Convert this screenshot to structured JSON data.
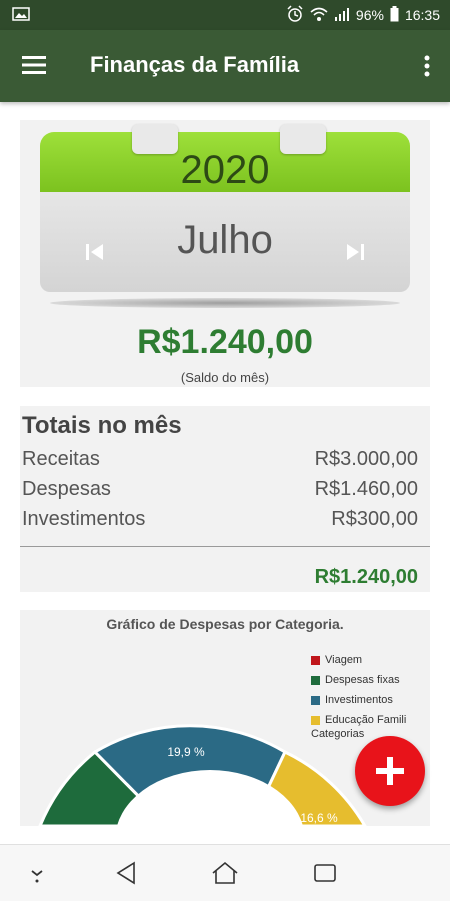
{
  "status_bar": {
    "battery": "96%",
    "time": "16:35",
    "icons": [
      "image-icon",
      "alarm-icon",
      "wifi-icon",
      "signal-icon",
      "battery-icon"
    ]
  },
  "app_bar": {
    "title": "Finanças da Família",
    "menu_icon": "hamburger-menu-icon",
    "more_icon": "more-vert-icon"
  },
  "calendar": {
    "year": "2020",
    "month": "Julho",
    "prev_icon": "skip-previous-icon",
    "next_icon": "skip-next-icon"
  },
  "balance": {
    "value": "R$1.240,00",
    "label": "(Saldo do mês)"
  },
  "totals": {
    "title": "Totais no mês",
    "rows": [
      {
        "label": "Receitas",
        "value": "R$3.000,00"
      },
      {
        "label": "Despesas",
        "value": "R$1.460,00"
      },
      {
        "label": "Investimentos",
        "value": "R$300,00"
      }
    ],
    "sum": "R$1.240,00"
  },
  "chart": {
    "title": "Gráfico de Despesas por Categoria.",
    "legend": [
      {
        "label": "Viagem",
        "color": "#c0161b"
      },
      {
        "label": "Despesas fixas",
        "color": "#1e6b3c"
      },
      {
        "label": "Investimentos",
        "color": "#2b6a85"
      },
      {
        "label": "Educação Famili",
        "color": "#e6bd2e"
      }
    ],
    "legend_caption": "Categorias",
    "visible_labels": [
      "19,9 %",
      "16,6 %"
    ]
  },
  "chart_data": {
    "type": "pie",
    "title": "Gráfico de Despesas por Categoria.",
    "categories": [
      "Viagem",
      "Despesas fixas",
      "Investimentos",
      "Educação Famili"
    ],
    "values_percent_shown": {
      "Investimentos": 19.9,
      "Educação Famili": 16.6
    },
    "legend_placement": "top-right",
    "legend_title": "Categorias"
  },
  "fab": {
    "icon": "plus-icon",
    "color": "#e8131a"
  },
  "nav_bar": {
    "icons": [
      "chevron-down-icon",
      "back-icon",
      "home-icon",
      "recents-icon"
    ]
  },
  "colors": {
    "primary": "#3a5a35",
    "status": "#2f4a2b",
    "positive": "#2e7d32",
    "calendar_green": "#8ed12a"
  }
}
